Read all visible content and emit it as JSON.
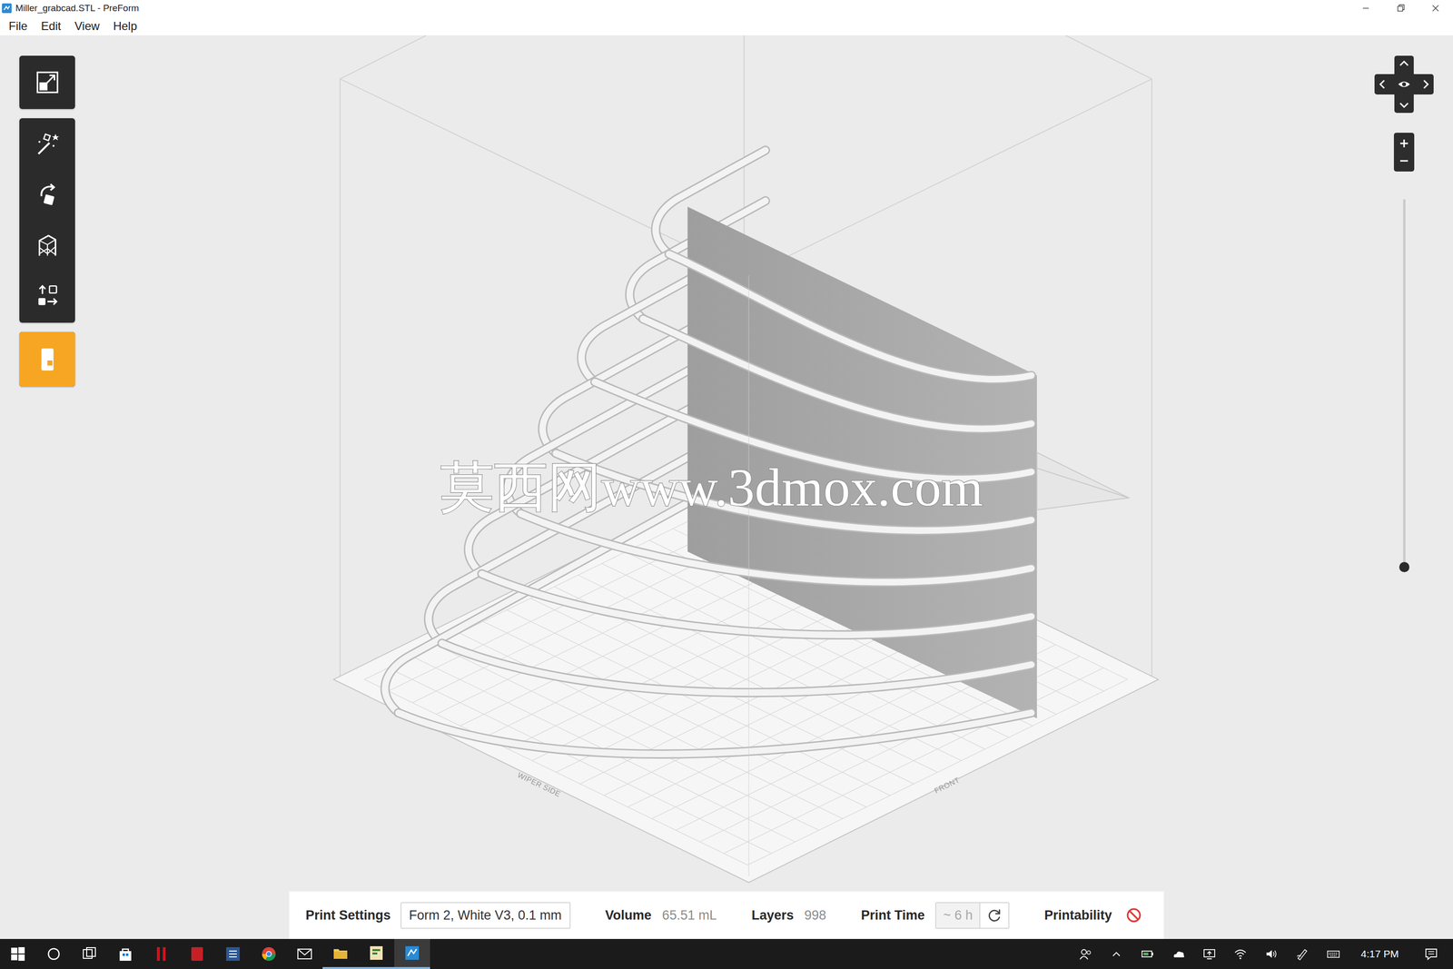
{
  "window": {
    "title": "Miller_grabcad.STL - PreForm"
  },
  "menu": [
    "File",
    "Edit",
    "View",
    "Help"
  ],
  "toolbar": [
    [
      {
        "kind": "fit",
        "selected": false
      }
    ],
    [
      {
        "kind": "magic",
        "selected": false
      },
      {
        "kind": "orient",
        "selected": false
      },
      {
        "kind": "supports",
        "selected": false
      },
      {
        "kind": "layout",
        "selected": false
      }
    ],
    [
      {
        "kind": "print",
        "selected": true
      }
    ]
  ],
  "viewport": {
    "watermark": "莫西网www.3dmox.com",
    "plate_labels": [
      "WIPER SIDE",
      "FRONT"
    ],
    "layer_slider": {
      "level": 0
    }
  },
  "status": {
    "print_settings_label": "Print Settings",
    "print_settings_value": "Form 2, White V3, 0.1 mm",
    "volume_label": "Volume",
    "volume": "65.51 mL",
    "layers_label": "Layers",
    "layers": "998",
    "print_time_label": "Print Time",
    "print_time": "~ 6 h",
    "print_time_disabled": true,
    "printability_label": "Printability",
    "printable": false
  },
  "taskbar": {
    "apps": [
      {
        "kind": "start",
        "running": false,
        "active": false
      },
      {
        "kind": "search",
        "running": false,
        "active": false
      },
      {
        "kind": "taskview",
        "running": false,
        "active": false
      },
      {
        "kind": "store",
        "running": false,
        "active": false
      },
      {
        "kind": "netflix",
        "running": false,
        "active": false
      },
      {
        "kind": "sapp",
        "running": false,
        "active": false
      },
      {
        "kind": "word",
        "running": false,
        "active": false
      },
      {
        "kind": "chrome",
        "running": false,
        "active": false
      },
      {
        "kind": "mail",
        "running": false,
        "active": false
      },
      {
        "kind": "explorer",
        "running": true,
        "active": false
      },
      {
        "kind": "fapp",
        "running": true,
        "active": false
      },
      {
        "kind": "preform",
        "running": true,
        "active": true
      }
    ],
    "tray": [
      "people",
      "chevron",
      "battery",
      "onedrive",
      "display",
      "wifi",
      "volume",
      "pen",
      "keyboard"
    ],
    "time": "4:17 PM"
  }
}
